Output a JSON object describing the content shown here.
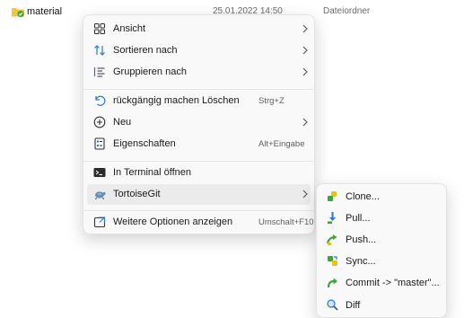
{
  "file": {
    "name": "material",
    "date": "25.01.2022 14:50",
    "type": "Dateiordner"
  },
  "menu": {
    "items": [
      {
        "label": "Ansicht",
        "icon": "grid-view-icon"
      },
      {
        "label": "Sortieren nach",
        "icon": "sort-icon"
      },
      {
        "label": "Gruppieren nach",
        "icon": "group-list-icon"
      },
      {
        "label": "rückgängig machen Löschen",
        "shortcut": "Strg+Z",
        "icon": "undo-icon"
      },
      {
        "label": "Neu",
        "icon": "new-plus-icon"
      },
      {
        "label": "Eigenschaften",
        "shortcut": "Alt+Eingabe",
        "icon": "properties-icon"
      },
      {
        "label": "In  Terminal öffnen",
        "icon": "terminal-icon"
      },
      {
        "label": "TortoiseGit",
        "icon": "tortoisegit-icon"
      },
      {
        "label": "Weitere Optionen anzeigen",
        "shortcut": "Umschalt+F10",
        "icon": "more-options-icon"
      }
    ]
  },
  "submenu": {
    "items": [
      {
        "label": "Clone...",
        "icon": "clone-icon"
      },
      {
        "label": "Pull...",
        "icon": "pull-icon"
      },
      {
        "label": "Push...",
        "icon": "push-icon"
      },
      {
        "label": "Sync...",
        "icon": "sync-icon"
      },
      {
        "label": "Commit -> \"master\"...",
        "icon": "commit-icon"
      },
      {
        "label": "Diff",
        "icon": "diff-icon"
      }
    ]
  },
  "colors": {
    "menu_bg": "#f9f9f9",
    "hover_bg": "#ebebeb",
    "icon_blue": "#2b78d0",
    "git_green": "#3aa53a",
    "git_yellow": "#e8c21a"
  }
}
